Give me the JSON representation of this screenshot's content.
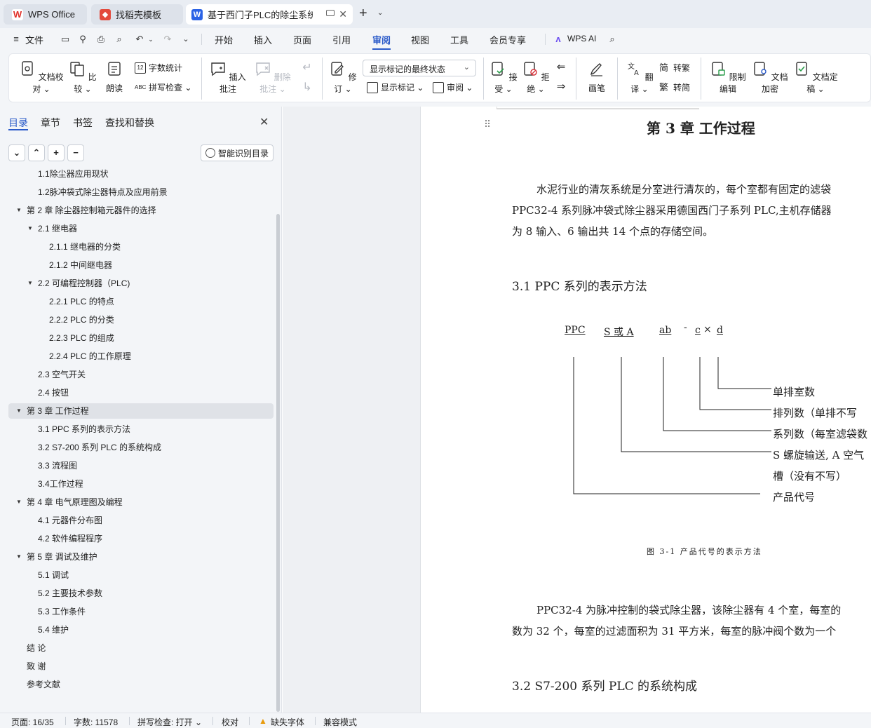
{
  "tabs": [
    {
      "label": "WPS Office"
    },
    {
      "label": "找稻壳模板"
    },
    {
      "label": "基于西门子PLC的除尘系统电气"
    }
  ],
  "menu": {
    "file": "文件",
    "items": [
      "开始",
      "插入",
      "页面",
      "引用",
      "审阅",
      "视图",
      "工具",
      "会员专享"
    ],
    "selected": "审阅",
    "wps_ai": "WPS AI"
  },
  "ribbon": {
    "doc_check": "文档校对",
    "compare": "比较",
    "read_aloud": "朗读",
    "word_count": "字数统计",
    "spell_check": "拼写检查",
    "insert_comment": "插入批注",
    "delete_comment": "删除批注",
    "revise": "修订",
    "markup_state": "显示标记的最终状态",
    "show_markup": "显示标记",
    "review": "审阅",
    "accept": "接受",
    "reject": "拒绝",
    "pen": "画笔",
    "translate": "翻译",
    "to_traditional": "转繁",
    "to_simplified": "转简",
    "restrict_edit": "限制编辑",
    "encrypt": "文档加密",
    "finalize": "文档定稿"
  },
  "panel": {
    "tabs": [
      "目录",
      "章节",
      "书签",
      "查找和替换"
    ],
    "smart_toc": "智能识别目录",
    "toc": [
      {
        "text": "1.1除尘器应用现状",
        "level": 2,
        "tri": false
      },
      {
        "text": "1.2脉冲袋式除尘器特点及应用前景",
        "level": 2,
        "tri": false
      },
      {
        "text": "第 2 章  除尘器控制箱元器件的选择",
        "level": 1,
        "tri": true
      },
      {
        "text": "2.1  继电器",
        "level": 2,
        "tri": true
      },
      {
        "text": "2.1.1  继电器的分类",
        "level": 3,
        "tri": false
      },
      {
        "text": "2.1.2  中间继电器",
        "level": 3,
        "tri": false
      },
      {
        "text": "2.2  可编程控制器（PLC)",
        "level": 2,
        "tri": true
      },
      {
        "text": "2.2.1    PLC 的特点",
        "level": 3,
        "tri": false
      },
      {
        "text": "2.2.2    PLC 的分类",
        "level": 3,
        "tri": false
      },
      {
        "text": "2.2.3    PLC 的组成",
        "level": 3,
        "tri": false
      },
      {
        "text": "2.2.4    PLC 的工作原理",
        "level": 3,
        "tri": false
      },
      {
        "text": "2.3  空气开关",
        "level": 2,
        "tri": false
      },
      {
        "text": "2.4  按钮",
        "level": 2,
        "tri": false
      },
      {
        "text": "第 3 章  工作过程",
        "level": 1,
        "tri": true,
        "highlight": true
      },
      {
        "text": "3.1    PPC 系列的表示方法",
        "level": 2,
        "tri": false
      },
      {
        "text": "3.2    S7-200 系列 PLC 的系统构成",
        "level": 2,
        "tri": false
      },
      {
        "text": "3.3    流程图",
        "level": 2,
        "tri": false
      },
      {
        "text": "3.4工作过程",
        "level": 2,
        "tri": false
      },
      {
        "text": " 第 4 章  电气原理图及编程",
        "level": 1,
        "tri": true
      },
      {
        "text": "4.1 元器件分布图",
        "level": 2,
        "tri": false
      },
      {
        "text": "4.2  软件编程程序",
        "level": 2,
        "tri": false
      },
      {
        "text": "第 5 章  调试及维护",
        "level": 1,
        "tri": true
      },
      {
        "text": "5.1  调试",
        "level": 2,
        "tri": false
      },
      {
        "text": "5.2  主要技术参数",
        "level": 2,
        "tri": false
      },
      {
        "text": "5.3  工作条件",
        "level": 2,
        "tri": false
      },
      {
        "text": "5.4  维护",
        "level": 2,
        "tri": false
      },
      {
        "text": "结  论",
        "level": 1,
        "tri": false
      },
      {
        "text": "致  谢",
        "level": 1,
        "tri": false
      },
      {
        "text": "参考文献",
        "level": 1,
        "tri": false
      }
    ]
  },
  "doc": {
    "chapter_title": "第 3 章  工作过程",
    "para1_line1": "水泥行业的清灰系统是分室进行清灰的，每个室都有固定的滤袋",
    "para1_line2": "PPC32-4 系列脉冲袋式除尘器采用德国西门子系列 PLC,主机存储器",
    "para1_line3": "为 8 输入、6 输出共 14 个点的存储空间。",
    "section_31": "3.1    PPC 系列的表示方法",
    "formula": {
      "ppc": "PPC",
      "s_or_a": "S 或 A",
      "ab": "ab",
      "dash": "-",
      "c": "c",
      "times": "×",
      "d": "d"
    },
    "labels": [
      "单排室数",
      "排列数（单排不写",
      "系列数（每室滤袋数",
      "S 螺旋输送, A 空气",
      "槽（没有不写）",
      "产品代号"
    ],
    "figure_caption": "图 3-1  产品代号的表示方法",
    "para2_line1": "PPC32-4 为脉冲控制的袋式除尘器，该除尘器有 4 个室，每室的",
    "para2_line2": "数为 32 个，每室的过滤面积为 31 平方米，每室的脉冲阀个数为一个",
    "section_32": "3.2    S7-200 系列 PLC 的系统构成"
  },
  "status": {
    "page": "页面: 16/35",
    "words": "字数: 11578",
    "spell": "拼写检查: 打开",
    "proof": "校对",
    "missing_font": "缺失字体",
    "compat": "兼容模式"
  },
  "colors": {
    "accent": "#2a5ac9",
    "wps_red": "#e0322b",
    "docer_red": "#e34a3c",
    "writer_blue": "#2b63e6"
  }
}
